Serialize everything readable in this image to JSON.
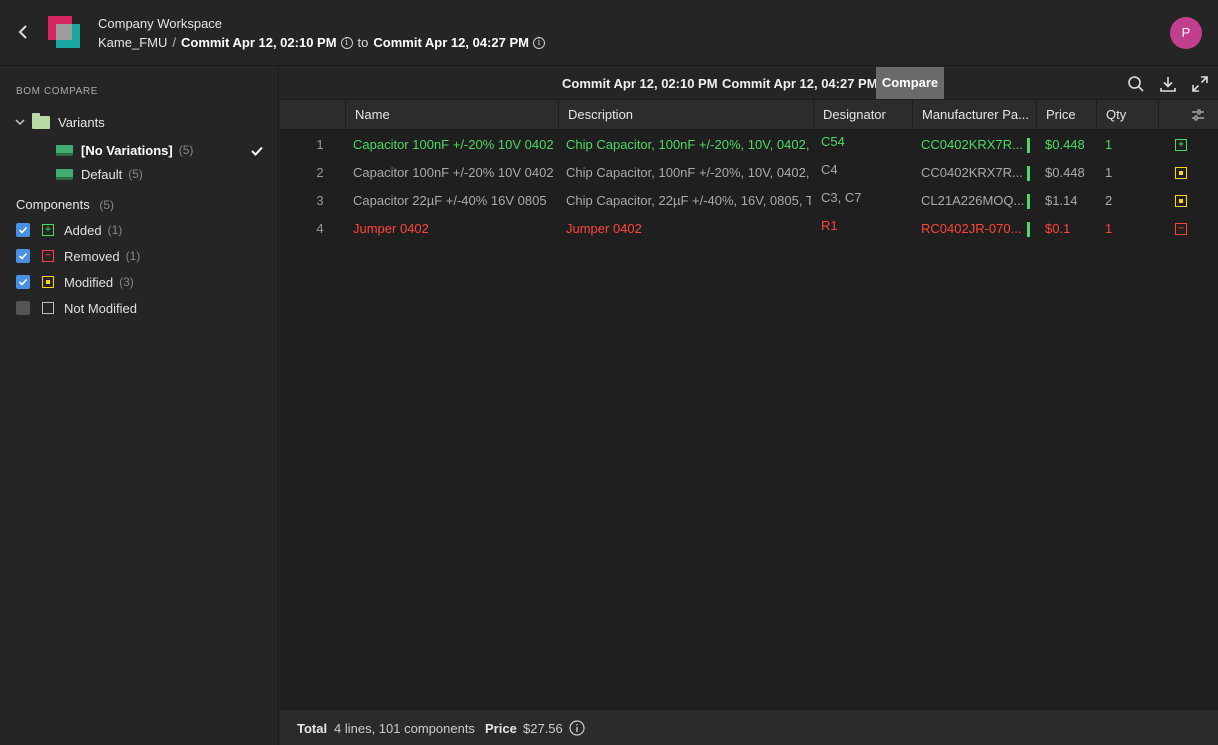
{
  "header": {
    "workspace": "Company Workspace",
    "project": "Kame_FMU",
    "separator": "/",
    "commit_from": "Commit Apr 12, 02:10 PM",
    "to_word": "to",
    "commit_to": "Commit Apr 12, 04:27 PM",
    "avatar_initial": "P"
  },
  "sidebar": {
    "title": "BOM COMPARE",
    "variants_label": "Variants",
    "variants": [
      {
        "label": "[No Variations]",
        "count": "(5)",
        "selected": true
      },
      {
        "label": "Default",
        "count": "(5)",
        "selected": false
      }
    ],
    "components_label": "Components",
    "components_count": "(5)",
    "filters": [
      {
        "label": "Added",
        "count": "(1)",
        "checked": true,
        "type": "added"
      },
      {
        "label": "Removed",
        "count": "(1)",
        "checked": true,
        "type": "removed"
      },
      {
        "label": "Modified",
        "count": "(3)",
        "checked": true,
        "type": "modified"
      },
      {
        "label": "Not Modified",
        "count": "",
        "checked": false,
        "type": "none"
      }
    ]
  },
  "toolbar": {
    "commit_a": "Commit Apr 12, 02:10 PM",
    "commit_b": "Commit Apr 12, 04:27 PM",
    "compare_label": "Compare"
  },
  "table": {
    "columns": [
      "Name",
      "Description",
      "Designator",
      "Manufacturer Pa...",
      "Price",
      "Qty"
    ],
    "rows": [
      {
        "num": "1",
        "name": "Capacitor 100nF +/-20% 10V 0402",
        "description": "Chip Capacitor, 100nF +/-20%, 10V, 0402,",
        "designator": "C54",
        "mpn": "CC0402KRX7R...",
        "price": "$0.448",
        "qty": "1",
        "status": "added"
      },
      {
        "num": "2",
        "name": "Capacitor 100nF +/-20% 10V 0402",
        "description": "Chip Capacitor, 100nF +/-20%, 10V, 0402,",
        "designator": "C4",
        "mpn": "CC0402KRX7R...",
        "price": "$0.448",
        "qty": "1",
        "status": "modified"
      },
      {
        "num": "3",
        "name": "Capacitor 22µF +/-40% 16V 0805",
        "description": "Chip Capacitor, 22µF +/-40%, 16V, 0805, T",
        "designator": "C3, C7",
        "mpn": "CL21A226MOQ...",
        "price": "$1.14",
        "qty": "2",
        "status": "modified"
      },
      {
        "num": "4",
        "name": "Jumper 0402",
        "description": "Jumper 0402",
        "designator": "R1",
        "mpn": "RC0402JR-070...",
        "price": "$0.1",
        "qty": "1",
        "status": "removed"
      }
    ]
  },
  "footer": {
    "total_label": "Total",
    "total_value": "4 lines, 101 components",
    "price_label": "Price",
    "price_value": "$27.56"
  },
  "colors": {
    "added": "#4cd964",
    "removed": "#ff453a",
    "modified": "#ffd60a",
    "accent": "#4a90e2"
  }
}
